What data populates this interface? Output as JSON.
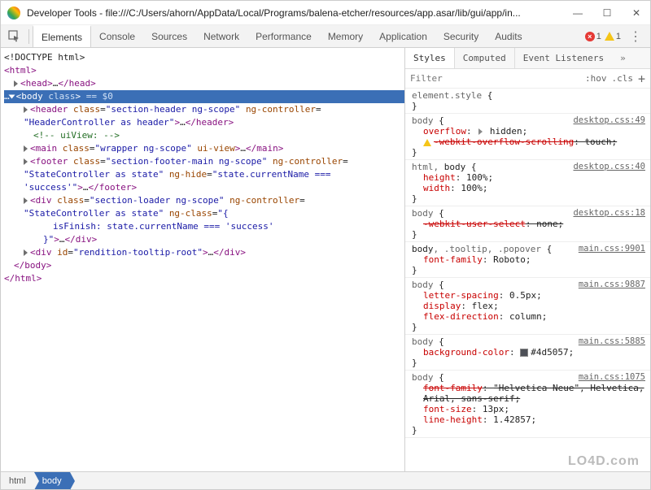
{
  "window": {
    "title": "Developer Tools - file:///C:/Users/ahorn/AppData/Local/Programs/balena-etcher/resources/app.asar/lib/gui/app/in..."
  },
  "tabs": [
    "Elements",
    "Console",
    "Sources",
    "Network",
    "Performance",
    "Memory",
    "Application",
    "Security",
    "Audits"
  ],
  "toolbar": {
    "errors": "1",
    "warnings": "1"
  },
  "dom": {
    "doctype": "<!DOCTYPE html>",
    "html_open": "html",
    "head": "head",
    "head_dots": "…",
    "body_sel": "body",
    "body_attr": "class",
    "body_eq": " == $0",
    "header_tag": "header",
    "header_class": "section-header ng-scope",
    "header_ctrl_attr": "ng-controller",
    "header_ctrl_val": "HeaderController as header",
    "header_dots": "…",
    "uiview_cmt": "<!-- uiView: -->",
    "main_tag": "main",
    "main_class": "wrapper ng-scope",
    "main_uv_attr": "ui-view",
    "main_dots": "…",
    "footer_tag": "footer",
    "footer_class": "section-footer-main ng-scope",
    "footer_ctrl_attr": "ng-controller",
    "footer_ctrl_val": "StateController as state",
    "footer_hide_attr": "ng-hide",
    "footer_hide_val": "state.currentName === 'success'",
    "footer_dots": "…",
    "div1_tag": "div",
    "div1_class": "section-loader ng-scope",
    "div1_ctrl_attr": "ng-controller",
    "div1_ctrl_val": "StateController as state",
    "div1_ngclass_attr": "ng-class",
    "div1_ngclass_val_open": "{",
    "div1_ngclass_line": "isFinish: state.currentName === 'success'",
    "div1_ngclass_close": "}",
    "div1_dots": "…",
    "div2_tag": "div",
    "div2_id_attr": "id",
    "div2_id_val": "rendition-tooltip-root",
    "div2_dots": "…",
    "body_close": "body",
    "html_close": "html"
  },
  "styleTabs": [
    "Styles",
    "Computed",
    "Event Listeners"
  ],
  "filter": {
    "placeholder": "Filter",
    "hov": ":hov",
    "cls": ".cls"
  },
  "rules": [
    {
      "selector": "element.style",
      "src": "",
      "props": []
    },
    {
      "selector": "body",
      "src": "desktop.css:49",
      "props": [
        {
          "name": "overflow",
          "value": "hidden;",
          "tri": true
        },
        {
          "name": "-webkit-overflow-scrolling",
          "value": "touch;",
          "strike": true,
          "warn": true
        }
      ]
    },
    {
      "selector_html": "html, <b>body</b>",
      "selraw": "html, body",
      "src": "desktop.css:40",
      "props": [
        {
          "name": "height",
          "value": "100%;"
        },
        {
          "name": "width",
          "value": "100%;"
        }
      ]
    },
    {
      "selector": "body",
      "src": "desktop.css:18",
      "props": [
        {
          "name": "-webkit-user-select",
          "value": "none;",
          "strike": true
        }
      ]
    },
    {
      "selector_html": "<b>body</b>, .tooltip, .popover",
      "selraw": "body, .tooltip, .popover",
      "src": "main.css:9901",
      "props": [
        {
          "name": "font-family",
          "value": "Roboto;"
        }
      ]
    },
    {
      "selector": "body",
      "src": "main.css:9887",
      "props": [
        {
          "name": "letter-spacing",
          "value": "0.5px;"
        },
        {
          "name": "display",
          "value": "flex;"
        },
        {
          "name": "flex-direction",
          "value": "column;"
        }
      ]
    },
    {
      "selector": "body",
      "src": "main.css:5885",
      "props": [
        {
          "name": "background-color",
          "value": "#4d5057;",
          "swatch": "#4d5057"
        }
      ]
    },
    {
      "selector": "body",
      "src": "main.css:1075",
      "props": [
        {
          "name": "font-family",
          "value": "\"Helvetica Neue\", Helvetica,",
          "strike": true
        },
        {
          "name": "",
          "value": "Arial, sans-serif;",
          "strike": true,
          "cont": true
        },
        {
          "name": "font-size",
          "value": "13px;"
        },
        {
          "name": "line-height",
          "value": "1.42857;"
        }
      ]
    }
  ],
  "crumbs": [
    "html",
    "body"
  ],
  "watermark": "LO4D.com"
}
